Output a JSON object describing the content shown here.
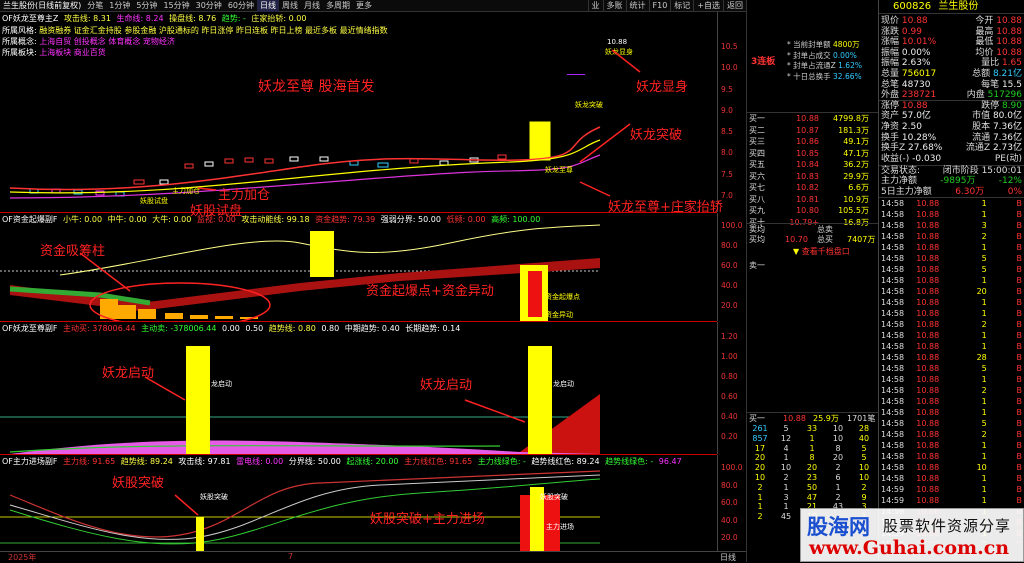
{
  "topbar": {
    "stock_title": "兰生股份(日线前复权)",
    "periods": [
      "分笔",
      "1分钟",
      "5分钟",
      "15分钟",
      "30分钟",
      "60分钟",
      "日线",
      "周线",
      "月线",
      "多周期",
      "更多"
    ],
    "active_period": "日线",
    "right_buttons": [
      "F10",
      "标记",
      "+自选",
      "返回"
    ],
    "right_extra": [
      "业",
      "多账",
      "统计"
    ]
  },
  "main_panel": {
    "title": "OF妖龙至尊主Z",
    "indicators": [
      {
        "label": "攻击线: 8.31",
        "color": "#ff4"
      },
      {
        "label": "生命线: 8.24",
        "color": "#f3f"
      },
      {
        "label": "操盘线: 8.76",
        "color": "#ff4"
      },
      {
        "label": "趋势: -",
        "color": "#3f3"
      },
      {
        "label": "庄家抬轿: 0.00",
        "color": "#ff4"
      }
    ],
    "info_lines": [
      {
        "label": "所属风格:",
        "value": "融资融券 证金汇金持股 参股金融 沪股通标的 昨日涨停 昨日连板 昨日上榜 最近多板 最近情绪指数"
      },
      {
        "label": "所属概念:",
        "value": "上海自贸 创投概念 体育概念 宠物经济"
      },
      {
        "label": "所属板块:",
        "value": "上海板块 商业百货"
      }
    ],
    "y_ticks": [
      "10.5",
      "10.0",
      "9.5",
      "9.0",
      "8.5",
      "8.0",
      "7.5",
      "7.0"
    ],
    "top_tag": "10.88",
    "labels": {
      "yaolong_xianshen": "妖龙显身",
      "yaolong_tupo": "妖龙突破",
      "yaolong_zhizun": "妖龙至尊",
      "zhuli_jiacang": "主力加仓",
      "yaogu_shipan": "妖股试盘"
    }
  },
  "panel2": {
    "title": "OF资金起爆副F",
    "indicators": [
      {
        "label": "小牛: 0.00",
        "color": "#ff4"
      },
      {
        "label": "中牛: 0.00",
        "color": "#ff4"
      },
      {
        "label": "大牛: 0.00",
        "color": "#ff4"
      },
      {
        "label": "监视: 0.00",
        "color": "#f33"
      },
      {
        "label": "攻击动能线: 99.18",
        "color": "#ff4"
      },
      {
        "label": "资金趋势: 79.39",
        "color": "#f33"
      },
      {
        "label": "强弱分界: 50.00",
        "color": "#fff"
      },
      {
        "label": "低频: 0.00",
        "color": "#f33"
      },
      {
        "label": "高频: 100.00",
        "color": "#3f3"
      }
    ],
    "y_ticks": [
      "100.0",
      "80.0",
      "60.0",
      "40.0",
      "20.0"
    ],
    "bar_labels": {
      "zhuli": "主力",
      "qibao": "资金起爆点",
      "yidong": "资金异动"
    }
  },
  "panel3": {
    "title": "OF妖龙至尊副F",
    "indicators": [
      {
        "label": "主动买: 378006.44",
        "color": "#f33"
      },
      {
        "label": "主动卖: -378006.44",
        "color": "#3f3"
      },
      {
        "label": "0.00",
        "color": "#fff"
      },
      {
        "label": "0.50",
        "color": "#fff"
      },
      {
        "label": "趋势线: 0.80",
        "color": "#ff4"
      },
      {
        "label": "0.80",
        "color": "#fff"
      },
      {
        "label": "中期趋势: 0.40",
        "color": "#fff"
      },
      {
        "label": "长期趋势: 0.14",
        "color": "#fff"
      }
    ],
    "y_ticks": [
      "1.20",
      "1.00",
      "0.80",
      "0.60",
      "0.40",
      "0.20"
    ],
    "bar_label": "龙启动"
  },
  "panel4": {
    "title": "OF主力进场副F",
    "indicators": [
      {
        "label": "主力线: 91.65",
        "color": "#f33"
      },
      {
        "label": "趋势线: 89.24",
        "color": "#ff4"
      },
      {
        "label": "攻击线: 97.81",
        "color": "#fff"
      },
      {
        "label": "雷电线: 0.00",
        "color": "#f3f"
      },
      {
        "label": "分界线: 50.00",
        "color": "#fff"
      },
      {
        "label": "起涨线: 20.00",
        "color": "#3f3"
      },
      {
        "label": "主力线红色: 91.65",
        "color": "#f33"
      },
      {
        "label": "主力线绿色: -",
        "color": "#3f3"
      },
      {
        "label": "趋势线红色: 89.24",
        "color": "#fff"
      },
      {
        "label": "趋势线绿色: -",
        "color": "#3f3"
      },
      {
        "label": "96.47",
        "color": "#f3f"
      }
    ],
    "y_ticks": [
      "100.0",
      "80.0",
      "60.0",
      "40.0",
      "20.0"
    ],
    "bar_labels": {
      "tupo": "妖股突破",
      "jinchang": "主力进场"
    }
  },
  "x_axis": {
    "left": "2025年",
    "mid": "7",
    "right": "日线"
  },
  "annotations": {
    "a1": "妖龙至尊 股海首发",
    "a2": "妖龙显身",
    "a3": "妖龙突破",
    "a4": "主力加仓",
    "a5": "妖股试盘",
    "a6": "妖龙至尊+庄家抬轿",
    "a7": "资金吸筹柱",
    "a8": "资金起爆点+资金异动",
    "a9": "妖龙启动",
    "a10": "妖龙启动",
    "a11": "妖股突破",
    "a12": "妖股突破+主力进场"
  },
  "right_panel": {
    "lianban": "3连板",
    "stats": [
      {
        "label": "当前封单额",
        "value": "4800万"
      },
      {
        "label": "封单占成交",
        "value": "0.00%"
      },
      {
        "label": "封单占流通Z",
        "value": "1.62%"
      },
      {
        "label": "十日总换手",
        "value": "32.66%"
      }
    ],
    "order_book": [
      {
        "label": "买一",
        "price": "10.88",
        "vol": "4799.8万"
      },
      {
        "label": "买二",
        "price": "10.87",
        "vol": "181.3万"
      },
      {
        "label": "买三",
        "price": "10.86",
        "vol": "49.1万"
      },
      {
        "label": "买四",
        "price": "10.85",
        "vol": "47.1万"
      },
      {
        "label": "买五",
        "price": "10.84",
        "vol": "36.2万"
      },
      {
        "label": "买六",
        "price": "10.83",
        "vol": "29.9万"
      },
      {
        "label": "买七",
        "price": "10.82",
        "vol": "6.6万"
      },
      {
        "label": "买八",
        "price": "10.81",
        "vol": "10.9万"
      },
      {
        "label": "买九",
        "price": "10.80",
        "vol": "105.5万"
      },
      {
        "label": "买十",
        "price": "10.79+",
        "vol": "16.8万"
      }
    ],
    "sell_avg": {
      "label": "卖均",
      "total_label": "总卖"
    },
    "buy_avg": {
      "label": "买均",
      "price": "10.70",
      "total_label": "总买",
      "total": "7407万"
    },
    "view_link": "查看千档盘口",
    "sell1": "卖一",
    "buy1_row": {
      "label": "买一",
      "price": "10.88",
      "vol": "25.9万",
      "count": "1701笔"
    },
    "queue": [
      [
        "261",
        "5",
        "33",
        "10",
        "28"
      ],
      [
        "857",
        "12",
        "1",
        "10",
        "40"
      ],
      [
        "17",
        "4",
        "1",
        "8",
        "5"
      ],
      [
        "20",
        "1",
        "8",
        "20",
        "5"
      ],
      [
        "20",
        "10",
        "20",
        "2",
        "10"
      ],
      [
        "10",
        "2",
        "23",
        "6",
        "10"
      ],
      [
        "2",
        "1",
        "50",
        "1",
        "2"
      ],
      [
        "1",
        "3",
        "47",
        "2",
        "9"
      ],
      [
        "1",
        "1",
        "21",
        "43",
        "3"
      ],
      [
        "2",
        "45",
        "10",
        "",
        "1"
      ]
    ]
  },
  "info_panel": {
    "code": "600826",
    "name": "兰生股份",
    "quote": [
      {
        "l1": "现价",
        "v1": "10.88",
        "c1": "red",
        "l2": "今开",
        "v2": "10.88",
        "c2": "red"
      },
      {
        "l1": "涨跌",
        "v1": "0.99",
        "c1": "red",
        "l2": "最高",
        "v2": "10.88",
        "c2": "red"
      },
      {
        "l1": "涨幅",
        "v1": "10.01%",
        "c1": "red",
        "l2": "最低",
        "v2": "10.88",
        "c2": "red"
      },
      {
        "l1": "振幅",
        "v1": "0.00%",
        "c1": "white",
        "l2": "均价",
        "v2": "10.88",
        "c2": "red"
      },
      {
        "l1": "振幅",
        "v1": "2.63%",
        "c1": "white",
        "l2": "量比",
        "v2": "1.65",
        "c2": "red"
      },
      {
        "l1": "总量",
        "v1": "756017",
        "c1": "yellow",
        "l2": "总额",
        "v2": "8.21亿",
        "c2": "cyan"
      },
      {
        "l1": "总笔",
        "v1": "48730",
        "c1": "white",
        "l2": "每笔",
        "v2": "15.5",
        "c2": "white"
      },
      {
        "l1": "外盘",
        "v1": "238721",
        "c1": "red",
        "l2": "内盘",
        "v2": "517296",
        "c2": "green"
      },
      {
        "l1": "涨停",
        "v1": "10.88",
        "c1": "red",
        "l2": "跌停",
        "v2": "8.90",
        "c2": "green"
      },
      {
        "l1": "资产",
        "v1": "57.0亿",
        "c1": "white",
        "l2": "市值",
        "v2": "80.0亿",
        "c2": "white"
      },
      {
        "l1": "净资",
        "v1": "2.50",
        "c1": "white",
        "l2": "股本",
        "v2": "7.36亿",
        "c2": "white"
      },
      {
        "l1": "换手",
        "v1": "10.28%",
        "c1": "white",
        "l2": "流通",
        "v2": "7.36亿",
        "c2": "white"
      },
      {
        "l1": "换手Z",
        "v1": "27.68%",
        "c1": "white",
        "l2": "流通Z",
        "v2": "2.73亿",
        "c2": "white"
      },
      {
        "l1": "收益(-)",
        "v1": "-0.030",
        "c1": "white",
        "l2": "PE(动)",
        "v2": "",
        "c2": "white"
      }
    ],
    "trade_state": {
      "label": "交易状态:",
      "value": "闭市阶段 15:00:01"
    },
    "net_flow": [
      {
        "label": "主力净额",
        "v1": "-9895万",
        "v2": "-12%"
      },
      {
        "label": "5日主力净额",
        "v1": "6.30万",
        "v2": "0%"
      }
    ],
    "ticks": [
      [
        "14:58",
        "10.88",
        "1",
        "B"
      ],
      [
        "14:58",
        "10.88",
        "1",
        "B"
      ],
      [
        "14:58",
        "10.88",
        "3",
        "B"
      ],
      [
        "14:58",
        "10.88",
        "2",
        "B"
      ],
      [
        "14:58",
        "10.88",
        "1",
        "B"
      ],
      [
        "14:58",
        "10.88",
        "5",
        "B"
      ],
      [
        "14:58",
        "10.88",
        "5",
        "B"
      ],
      [
        "14:58",
        "10.88",
        "1",
        "B"
      ],
      [
        "14:58",
        "10.88",
        "20",
        "B"
      ],
      [
        "14:58",
        "10.88",
        "1",
        "B"
      ],
      [
        "14:58",
        "10.88",
        "1",
        "B"
      ],
      [
        "14:58",
        "10.88",
        "2",
        "B"
      ],
      [
        "14:58",
        "10.88",
        "1",
        "B"
      ],
      [
        "14:58",
        "10.88",
        "1",
        "B"
      ],
      [
        "14:58",
        "10.88",
        "28",
        "B"
      ],
      [
        "14:58",
        "10.88",
        "5",
        "B"
      ],
      [
        "14:58",
        "10.88",
        "1",
        "B"
      ],
      [
        "14:58",
        "10.88",
        "2",
        "B"
      ],
      [
        "14:58",
        "10.88",
        "1",
        "B"
      ],
      [
        "14:58",
        "10.88",
        "1",
        "B"
      ],
      [
        "14:58",
        "10.88",
        "5",
        "B"
      ],
      [
        "14:58",
        "10.88",
        "2",
        "B"
      ],
      [
        "14:58",
        "10.88",
        "1",
        "B"
      ],
      [
        "14:58",
        "10.88",
        "1",
        "B"
      ],
      [
        "14:58",
        "10.88",
        "10",
        "B"
      ],
      [
        "14:58",
        "10.88",
        "1",
        "B"
      ],
      [
        "14:59",
        "10.88",
        "1",
        "B"
      ],
      [
        "14:59",
        "10.88",
        "1",
        "B"
      ],
      [
        "14:59",
        "10.88",
        "1",
        "B"
      ],
      [
        "14:59",
        "10.88",
        "1",
        "B"
      ],
      [
        "14:59",
        "10.88",
        "1",
        "B"
      ],
      [
        "15:00",
        "10.88",
        "2",
        "B"
      ]
    ]
  },
  "watermark": {
    "logo": "股海网",
    "slogan": "股票软件资源分享",
    "url": "www.Guhai.com.cn"
  },
  "colors": {
    "up": "#ff3333",
    "down": "#22cc22",
    "accent": "#ffff00",
    "bg": "#000000"
  }
}
